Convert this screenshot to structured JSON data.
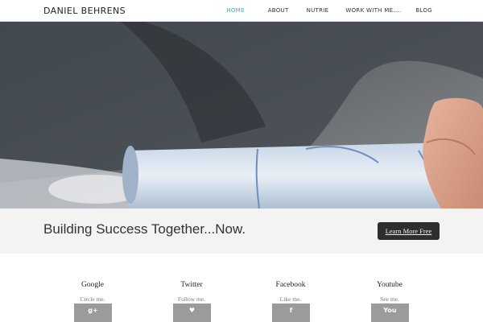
{
  "brand": "DANIEL BEHRENS",
  "nav": [
    {
      "label": "HOME",
      "active": true
    },
    {
      "label": "ABOUT",
      "active": false
    },
    {
      "label": "NUTRIE",
      "active": false
    },
    {
      "label": "WORK WITH ME....",
      "active": false
    },
    {
      "label": "BLOG",
      "active": false
    }
  ],
  "callout": {
    "title": "Building Success Together...Now.",
    "button_label": "Learn More Free"
  },
  "social": [
    {
      "title": "Google",
      "subtitle": "Circle me.",
      "icon_glyph": "g+",
      "icon": "google-plus-icon"
    },
    {
      "title": "Twitter",
      "subtitle": "Follow me.",
      "icon_glyph": "♥",
      "icon": "twitter-bird-icon"
    },
    {
      "title": "Facebook",
      "subtitle": "Like me.",
      "icon_glyph": "f",
      "icon": "facebook-icon"
    },
    {
      "title": "Youtube",
      "subtitle": "See me.",
      "icon_glyph": "You",
      "icon": "youtube-icon"
    }
  ],
  "colors": {
    "accent": "#4ea7c4",
    "button_bg": "#2e2e2e",
    "callout_bg": "#f3f3f3",
    "icon_bg": "#9b9b9b"
  }
}
